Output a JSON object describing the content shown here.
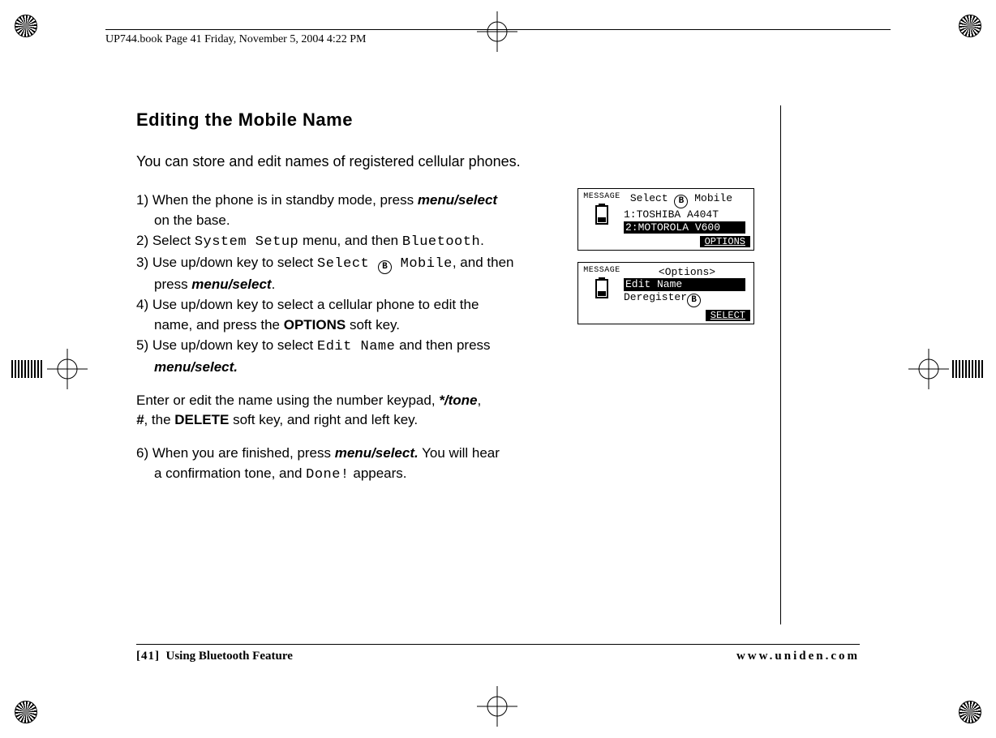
{
  "runhead": "UP744.book  Page 41  Friday, November 5, 2004  4:22 PM",
  "title": "Editing the Mobile Name",
  "intro": "You can store and edit names of registered cellular phones.",
  "steps": {
    "s1a": "1) When the phone is in standby mode, press ",
    "s1b": "menu/select",
    "s1c": "on the base.",
    "s2a": "2) Select ",
    "s2b": "System Setup",
    "s2c": " menu, and then ",
    "s2d": "Bluetooth",
    "s2e": ".",
    "s3a": "3) Use up/down key to select ",
    "s3b": "Select ",
    "s3c": " Mobile",
    "s3d": ", and then",
    "s3e": "press ",
    "s3f": "menu/select",
    "s3g": ".",
    "s4a": "4) Use up/down key to select a cellular phone to edit the",
    "s4b": "name, and press the ",
    "s4c": "OPTIONS",
    "s4d": " soft key.",
    "s5a": "5) Use up/down key to select ",
    "s5b": "Edit Name",
    "s5c": " and then press",
    "s5d": "menu/select.",
    "mid1a": "Enter or edit the name using the number keypad, ",
    "mid1b": "*/tone",
    "mid1c": ",",
    "mid2a": "#",
    "mid2b": ", the ",
    "mid2c": "DELETE",
    "mid2d": " soft key, and right and left key.",
    "s6a": "6) When you are finished, press ",
    "s6b": "menu/select.",
    "s6c": " You will hear",
    "s6d": "a confirmation tone, and ",
    "s6e": "Done!",
    "s6f": " appears."
  },
  "screens": {
    "msg_label": "MESSAGE",
    "circ_b": "B",
    "screen1": {
      "line1a": "Select ",
      "line1b": " Mobile",
      "line2": "1:TOSHIBA A404T",
      "line3": "2:MOTOROLA V600",
      "softkey": "OPTIONS"
    },
    "screen2": {
      "line1": "<Options>",
      "line2": "Edit Name",
      "line3a": "Deregister",
      "softkey": "SELECT"
    }
  },
  "footer": {
    "page_label": "[41]",
    "section": "Using Bluetooth Feature",
    "url": "www.uniden.com"
  }
}
